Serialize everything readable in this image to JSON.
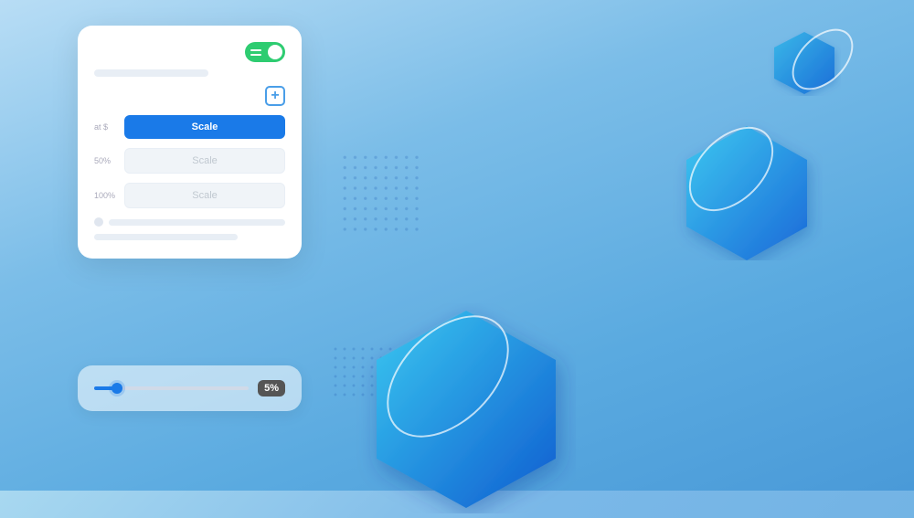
{
  "background": {
    "color_start": "#b8ddf5",
    "color_end": "#4a9ad8"
  },
  "main_card": {
    "toggle_on": true,
    "add_button_label": "+",
    "scale_label_active": "Scale",
    "scale_label_50": "Scale",
    "scale_label_100": "Scale",
    "pct_50": "50%",
    "pct_100": "100%",
    "pct_active": "at $"
  },
  "reflection_card": {
    "slider_value": "5%",
    "slider_percent": 15
  },
  "hexagons": {
    "small_label": "hex-small",
    "medium_label": "hex-medium",
    "large_label": "hex-large"
  },
  "dot_patterns": {
    "visible": true
  }
}
